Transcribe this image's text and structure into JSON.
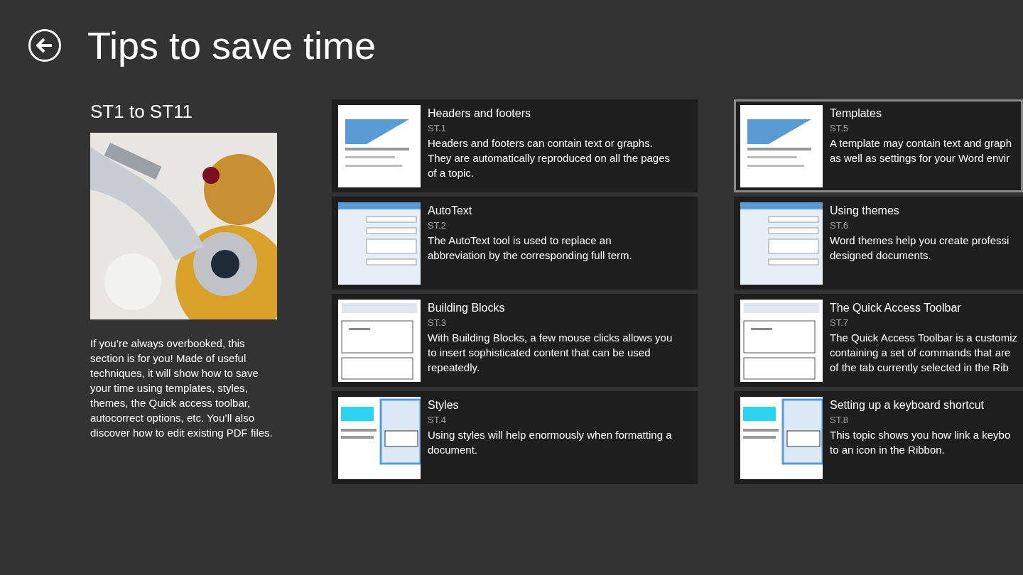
{
  "page": {
    "title": "Tips to save time"
  },
  "section": {
    "title": "ST1 to ST11",
    "description": "If you’re always overbooked, this section is for you! Made of useful techniques, it will show how to save your time using templates, styles, themes, the Quick access toolbar, autocorrect options, etc. You’ll also discover how to edit existing PDF files."
  },
  "columns": [
    {
      "cards": [
        {
          "title": "Headers and footers",
          "code": "ST.1",
          "lines": [
            "Headers and footers can contain text or graphs.",
            "They are automatically reproduced on all the pages",
            "of a topic."
          ],
          "selected": false
        },
        {
          "title": "AutoText",
          "code": "ST.2",
          "lines": [
            "The AutoText tool is used to replace an",
            "abbreviation by the corresponding full term."
          ],
          "selected": false
        },
        {
          "title": "Building Blocks",
          "code": "ST.3",
          "lines": [
            "With Building Blocks, a few mouse clicks allows you",
            "to insert sophisticated content that can be used",
            "repeatedly."
          ],
          "selected": false
        },
        {
          "title": "Styles",
          "code": "ST.4",
          "lines": [
            "Using styles will help enormously when formatting a",
            "document."
          ],
          "selected": false
        }
      ]
    },
    {
      "cards": [
        {
          "title": "Templates",
          "code": "ST.5",
          "lines": [
            "A template may contain text and graph",
            "as well as settings for your Word envir"
          ],
          "selected": true
        },
        {
          "title": "Using themes",
          "code": "ST.6",
          "lines": [
            "Word themes help you create professi",
            "designed documents."
          ],
          "selected": false
        },
        {
          "title": "The Quick Access Toolbar",
          "code": "ST.7",
          "lines": [
            "The Quick Access Toolbar is a customiz",
            "containing a set of commands that are",
            "of the tab currently selected in the Rib"
          ],
          "selected": false
        },
        {
          "title": "Setting up a keyboard shortcut",
          "code": "ST.8",
          "lines": [
            "This topic shows you how link a keybo",
            "to an icon in the Ribbon."
          ],
          "selected": false
        }
      ]
    }
  ]
}
